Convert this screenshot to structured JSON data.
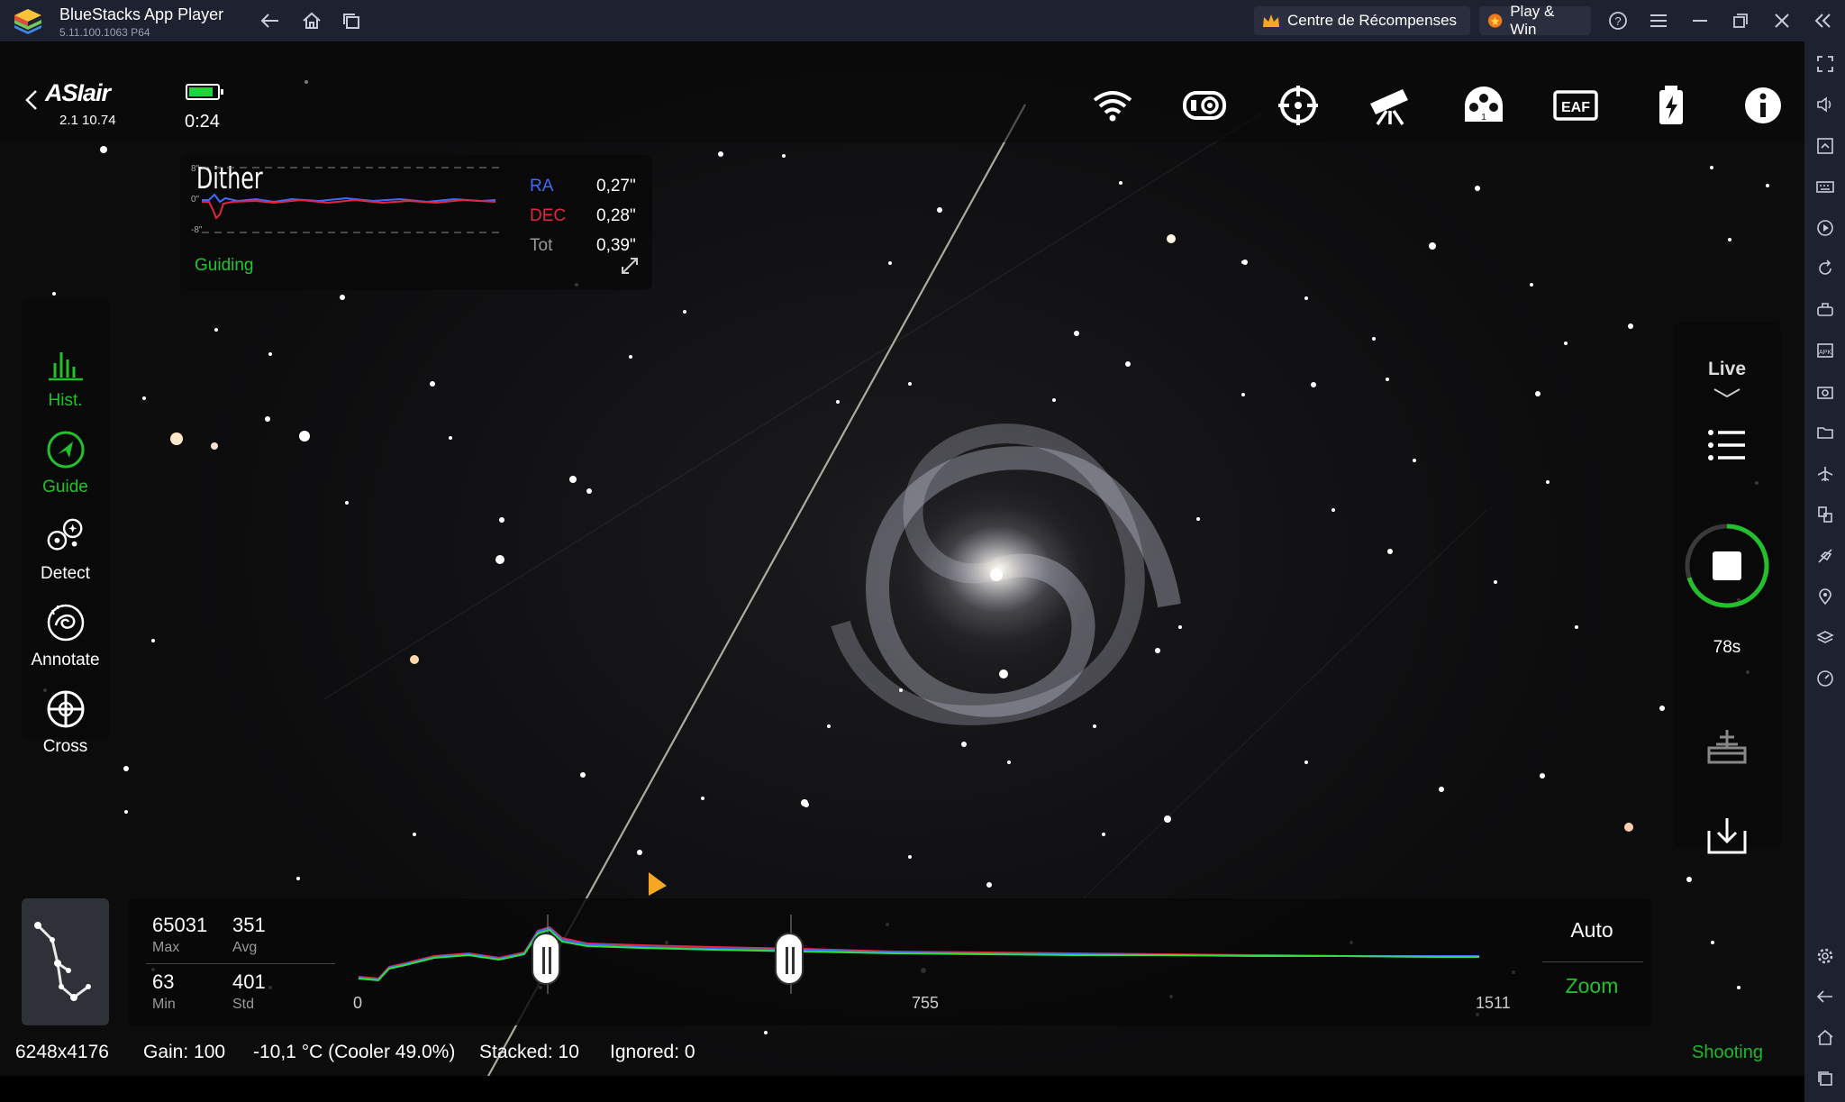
{
  "window": {
    "title": "BlueStacks App Player",
    "version": "5.11.100.1063  P64",
    "rewards_button": "Centre de  Récompenses",
    "play_win_button": "Play & Win"
  },
  "app": {
    "logo": "ASIair",
    "version": "2.1 10.74",
    "timer": "0:24",
    "battery_level": 0.85,
    "top_icons": [
      "wifi-icon",
      "camera-filter-icon",
      "guide-crosshair-icon",
      "telescope-mount-icon",
      "filter-wheel-icon",
      "eaf-icon",
      "power-usb-icon",
      "info-icon"
    ],
    "eaf_label": "EAF"
  },
  "guiding_panel": {
    "title": "Dither",
    "status": "Guiding",
    "axis_top": "8\"",
    "axis_mid": "0\"",
    "axis_bottom": "-8\"",
    "rows": [
      {
        "label": "RA",
        "value": "0,27\"",
        "color": "#3c6cff"
      },
      {
        "label": "DEC",
        "value": "0,28\"",
        "color": "#e3263f"
      },
      {
        "label": "Tot",
        "value": "0,39\"",
        "color": "#9a9a9a"
      }
    ]
  },
  "left_tools": [
    {
      "label": "Hist.",
      "icon": "histogram-icon",
      "active": true
    },
    {
      "label": "Guide",
      "icon": "guide-icon",
      "active": true
    },
    {
      "label": "Detect",
      "icon": "detect-stars-icon",
      "active": false
    },
    {
      "label": "Annotate",
      "icon": "annotate-icon",
      "active": false
    },
    {
      "label": "Cross",
      "icon": "crosshair-icon",
      "active": false
    }
  ],
  "right_panel": {
    "mode": "Live",
    "exposure_remaining": "78s",
    "icons": [
      "mode-chevron-icon",
      "list-icon",
      "stop-icon",
      "stack-icon",
      "download-icon"
    ],
    "progress": 0.7
  },
  "histogram": {
    "max": "65031",
    "max_label": "Max",
    "avg": "351",
    "avg_label": "Avg",
    "min": "63",
    "min_label": "Min",
    "std": "401",
    "std_label": "Std",
    "tick_left": "0",
    "tick_mid": "755",
    "tick_right": "1511",
    "auto_label": "Auto",
    "zoom_label": "Zoom"
  },
  "status": {
    "resolution": "6248x4176",
    "gain": "Gain: 100",
    "temperature": "-10,1 °C (Cooler 49.0%)",
    "stacked": "Stacked: 10",
    "ignored": "Ignored: 0",
    "state": "Shooting"
  },
  "colors": {
    "accent_green": "#22c12c",
    "ra_blue": "#3c6cff",
    "dec_red": "#e3263f",
    "bluestacks_bar": "#1e2130"
  }
}
